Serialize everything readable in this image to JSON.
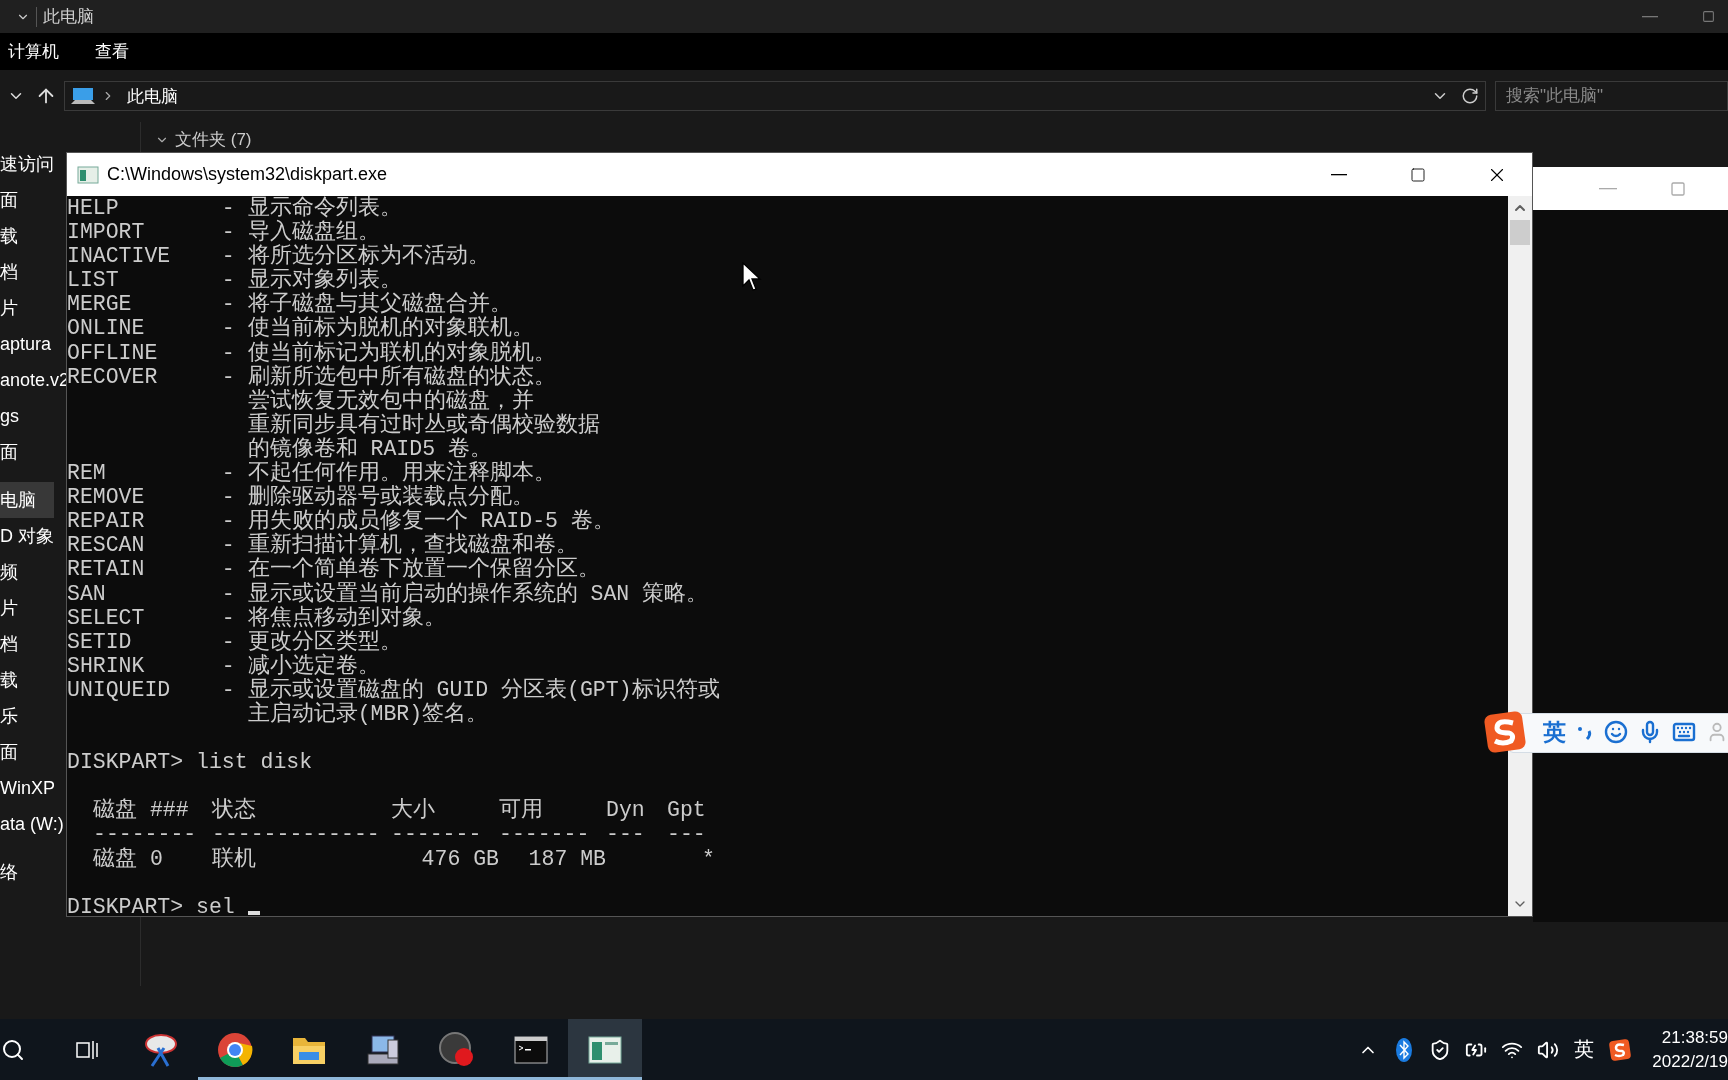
{
  "explorer": {
    "title": "此电脑",
    "menu": [
      "计算机",
      "查看"
    ],
    "address": "此电脑",
    "search": {
      "placeholder": "搜索\"此电脑\""
    },
    "sidebar": {
      "groups": [
        {
          "items": [
            {
              "label": "速访问",
              "selected": false
            },
            {
              "label": "面",
              "selected": false
            },
            {
              "label": "载",
              "selected": false
            },
            {
              "label": "档",
              "selected": false
            },
            {
              "label": "片",
              "selected": false
            },
            {
              "label": "aptura",
              "selected": false
            },
            {
              "label": "anote.v2",
              "selected": false
            },
            {
              "label": "gs",
              "selected": false
            },
            {
              "label": "面",
              "selected": false
            }
          ]
        },
        {
          "items": [
            {
              "label": "电脑",
              "selected": true
            },
            {
              "label": "D 对象",
              "selected": false
            },
            {
              "label": "频",
              "selected": false
            },
            {
              "label": "片",
              "selected": false
            },
            {
              "label": "档",
              "selected": false
            },
            {
              "label": "载",
              "selected": false
            },
            {
              "label": "乐",
              "selected": false
            },
            {
              "label": "面",
              "selected": false
            },
            {
              "label": "WinXP",
              "selected": false
            },
            {
              "label": "ata (W:)",
              "selected": false
            }
          ]
        },
        {
          "items": [
            {
              "label": "络",
              "selected": false
            }
          ]
        }
      ]
    },
    "content": {
      "group_header": "文件夹 (7)"
    }
  },
  "console": {
    "title": "C:\\Windows\\system32\\diskpart.exe",
    "help_lines": [
      "HELP        - 显示命令列表。",
      "IMPORT      - 导入磁盘组。",
      "INACTIVE    - 将所选分区标为不活动。",
      "LIST        - 显示对象列表。",
      "MERGE       - 将子磁盘与其父磁盘合并。",
      "ONLINE      - 使当前标为脱机的对象联机。",
      "OFFLINE     - 使当前标记为联机的对象脱机。",
      "RECOVER     - 刷新所选包中所有磁盘的状态。",
      "              尝试恢复无效包中的磁盘，并",
      "              重新同步具有过时丛或奇偶校验数据",
      "              的镜像卷和 RAID5 卷。",
      "REM         - 不起任何作用。用来注释脚本。",
      "REMOVE      - 删除驱动器号或装载点分配。",
      "REPAIR      - 用失败的成员修复一个 RAID-5 卷。",
      "RESCAN      - 重新扫描计算机，查找磁盘和卷。",
      "RETAIN      - 在一个简单卷下放置一个保留分区。",
      "SAN         - 显示或设置当前启动的操作系统的 SAN 策略。",
      "SELECT      - 将焦点移动到对象。",
      "SETID       - 更改分区类型。",
      "SHRINK      - 减小选定卷。",
      "UNIQUEID    - 显示或设置磁盘的 GUID 分区表(GPT)标识符或",
      "              主启动记录(MBR)签名。"
    ],
    "command_1": {
      "prompt": "DISKPART>",
      "input": "list disk"
    },
    "disk_table": {
      "columns": [
        {
          "label": "磁盘 ###",
          "rule": "--------"
        },
        {
          "label": "状态",
          "rule": "-------------"
        },
        {
          "label": "大小",
          "rule": "-------"
        },
        {
          "label": "可用",
          "rule": "-------"
        },
        {
          "label": "Dyn",
          "rule": "---"
        },
        {
          "label": "Gpt",
          "rule": "---"
        }
      ],
      "rows": [
        {
          "disk": "磁盘 0",
          "status": "联机",
          "size": "476 GB",
          "free": "187 MB",
          "gpt": "*"
        }
      ]
    },
    "command_2": {
      "prompt": "DISKPART>",
      "input": "sel"
    }
  },
  "ime_bar": {
    "mode": "英"
  },
  "taskbar": {
    "apps": [
      {
        "kind": "snip",
        "running": false,
        "active": false
      },
      {
        "kind": "chrome",
        "running": true,
        "active": false
      },
      {
        "kind": "folder",
        "running": true,
        "active": false
      },
      {
        "kind": "network",
        "running": true,
        "active": false
      },
      {
        "kind": "recorder",
        "running": true,
        "active": false
      },
      {
        "kind": "terminal",
        "running": true,
        "active": false
      },
      {
        "kind": "diskpart",
        "running": true,
        "active": true
      }
    ],
    "tray": {
      "input_mode": "英",
      "time": "21:38:59",
      "date": "2022/2/19"
    }
  }
}
